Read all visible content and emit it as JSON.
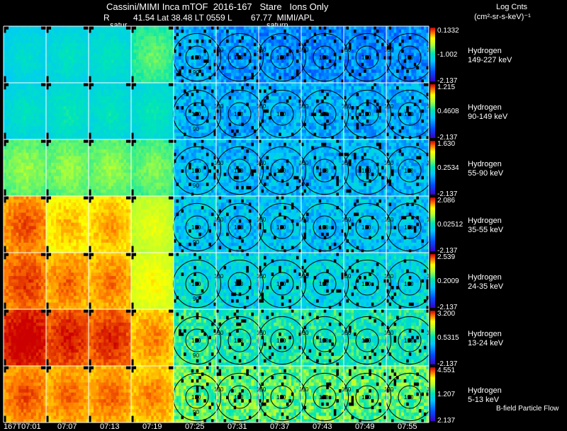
{
  "header": {
    "title": "Cassini/MIMI Inca mTOF  2016-167   Stare   Ions Only",
    "meta": "R          41.54 Lat 38.48 LT 0559 L        67.77  MIMI/APL",
    "panel_notes": [
      "satur",
      "saturn"
    ],
    "units_line1": "Log Cnts",
    "units_line2": "(cm²-sr-s-keV)⁻¹"
  },
  "footer": {
    "bfield_label": "B-field Particle Flow"
  },
  "chart_data": {
    "type": "heatmap",
    "time_labels": [
      "167T07:01",
      "07:07",
      "07:13",
      "07:19",
      "07:25",
      "07:31",
      "07:37",
      "07:43",
      "07:49",
      "07:55"
    ],
    "contour_labels": [
      "90",
      "120",
      "150"
    ],
    "colors": {
      "scale_top": "#cc0000",
      "scale_mid_high": "#ffff00",
      "scale_mid": "#00e6b4",
      "scale_mid_low": "#0050ff",
      "scale_bottom": "#3a00c8",
      "grid": "#ffffff",
      "background": "#000000"
    },
    "rows": [
      {
        "species": "Hydrogen",
        "energy": "149-227 keV",
        "cmax": "0.1332",
        "cmid": "-1.002",
        "cmin": "-2.137",
        "level": [
          0.42,
          0.44,
          0.45,
          0.55,
          0.34,
          0.3,
          0.28,
          0.28,
          0.28,
          0.28
        ]
      },
      {
        "species": "Hydrogen",
        "energy": "90-149 keV",
        "cmax": "1.215",
        "cmid": "0.4608",
        "cmin": "-2.137",
        "level": [
          0.44,
          0.46,
          0.45,
          0.46,
          0.36,
          0.34,
          0.34,
          0.34,
          0.34,
          0.34
        ]
      },
      {
        "species": "Hydrogen",
        "energy": "55-90 keV",
        "cmax": "1.630",
        "cmid": "0.2534",
        "cmin": "-2.137",
        "level": [
          0.6,
          0.6,
          0.6,
          0.58,
          0.38,
          0.36,
          0.36,
          0.36,
          0.36,
          0.36
        ]
      },
      {
        "species": "Hydrogen",
        "energy": "35-55 keV",
        "cmax": "2.086",
        "cmid": "0.02512",
        "cmin": "-2.137",
        "level": [
          0.88,
          0.8,
          0.82,
          0.7,
          0.4,
          0.38,
          0.4,
          0.38,
          0.38,
          0.38
        ]
      },
      {
        "species": "Hydrogen",
        "energy": "24-35 keV",
        "cmax": "2.539",
        "cmid": "0.2009",
        "cmin": "-2.137",
        "level": [
          0.9,
          0.86,
          0.85,
          0.74,
          0.46,
          0.44,
          0.44,
          0.44,
          0.44,
          0.44
        ]
      },
      {
        "species": "Hydrogen",
        "energy": "13-24 keV",
        "cmax": "3.200",
        "cmid": "0.5315",
        "cmin": "-2.137",
        "level": [
          0.97,
          0.93,
          0.92,
          0.84,
          0.55,
          0.52,
          0.52,
          0.52,
          0.52,
          0.52
        ]
      },
      {
        "species": "Hydrogen",
        "energy": "5-13 keV",
        "cmax": "4.551",
        "cmid": "1.207",
        "cmin": "2.137",
        "level": [
          0.88,
          0.86,
          0.86,
          0.84,
          0.62,
          0.6,
          0.6,
          0.6,
          0.6,
          0.6
        ]
      }
    ]
  }
}
